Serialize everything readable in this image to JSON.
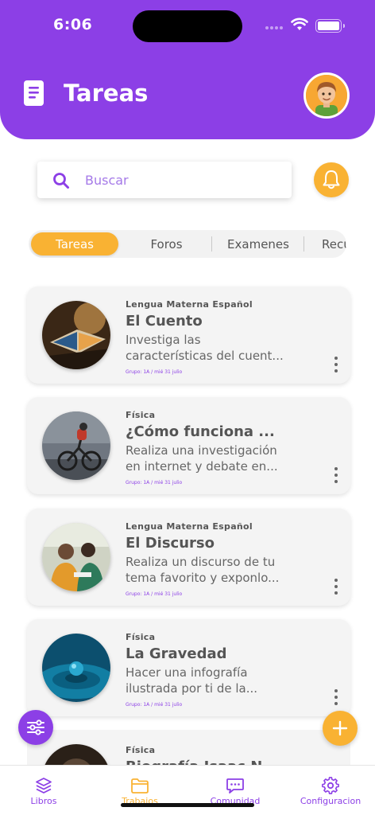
{
  "status_bar": {
    "time": "6:06"
  },
  "header": {
    "title": "Tareas"
  },
  "search": {
    "placeholder": "Buscar"
  },
  "tabs": [
    {
      "label": "Tareas",
      "active": true
    },
    {
      "label": "Foros",
      "active": false
    },
    {
      "label": "Examenes",
      "active": false
    },
    {
      "label": "Recu",
      "active": false
    }
  ],
  "cards": [
    {
      "subject": "Lengua Materna Español",
      "title": "El Cuento",
      "desc_line1": "Investiga las",
      "desc_line2": "características del cuent...",
      "meta": "Grupo: 1A / mié 31 julio"
    },
    {
      "subject": "Física",
      "title": "¿Cómo funciona ...",
      "desc_line1": "Realiza una investigación",
      "desc_line2": "en internet y debate en...",
      "meta": "Grupo: 1A / mié 31 julio"
    },
    {
      "subject": "Lengua Materna Español",
      "title": "El Discurso",
      "desc_line1": "Realiza un discurso de tu",
      "desc_line2": "tema favorito y exponlo...",
      "meta": "Grupo: 1A / mié 31 julio"
    },
    {
      "subject": "Física",
      "title": "La Gravedad",
      "desc_line1": "Hacer una infografía",
      "desc_line2": "ilustrada por ti de la...",
      "meta": "Grupo: 1A / mié 31 julio"
    }
  ],
  "partial_card": {
    "subject": "Física",
    "title": "Biografía Isaac N..."
  },
  "bottom_nav": [
    {
      "label": "Libros",
      "icon": "layers-icon",
      "active": false
    },
    {
      "label": "Trabajos",
      "icon": "folder-icon",
      "active": true
    },
    {
      "label": "Comunidad",
      "icon": "chat-icon",
      "active": false
    },
    {
      "label": "Configuracion",
      "icon": "gear-icon",
      "active": false
    }
  ],
  "colors": {
    "primary": "#8c3fe6",
    "accent": "#f9b233",
    "card_bg": "#f4f4f4",
    "text": "#555555"
  }
}
